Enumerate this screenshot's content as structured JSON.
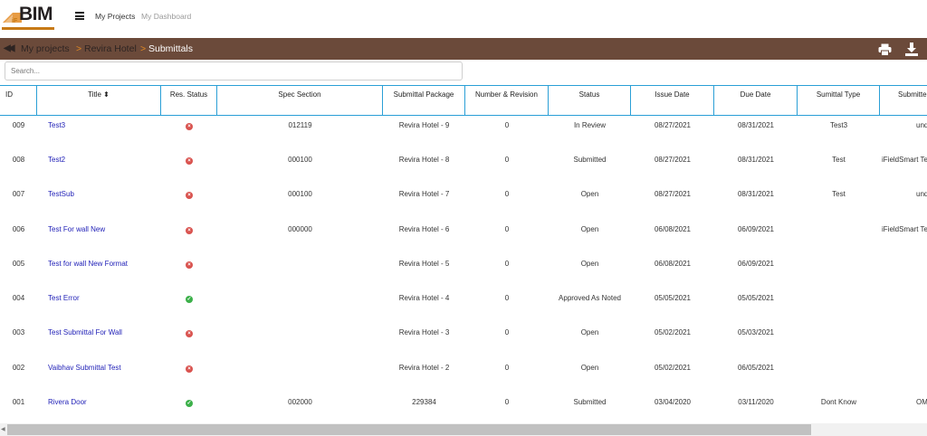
{
  "header": {
    "logo_text": "BIM",
    "logo_small": "iF",
    "nav": [
      "My Projects",
      "My Dashboard"
    ]
  },
  "breadcrumb": {
    "items": [
      "My projects",
      "Revira Hotel",
      "Submittals"
    ],
    "separator": ">"
  },
  "search": {
    "placeholder": "Search..."
  },
  "table": {
    "columns": [
      "ID",
      "Title ⬍",
      "Res. Status",
      "Spec Section",
      "Submittal Package",
      "Number & Revision",
      "Status",
      "Issue Date",
      "Due Date",
      "Sumittal Type",
      "Submitte"
    ],
    "rows": [
      {
        "id": "009",
        "title": "Test3",
        "res_status": "rejected",
        "spec": "012119",
        "package": "Revira Hotel - 9",
        "number": "0",
        "status": "In Review",
        "issue": "08/27/2021",
        "due": "08/31/2021",
        "type": "Test3",
        "submitter": "undefir"
      },
      {
        "id": "008",
        "title": "Test2",
        "res_status": "rejected",
        "spec": "000100",
        "package": "Revira Hotel - 8",
        "number": "0",
        "status": "Submitted",
        "issue": "08/27/2021",
        "due": "08/31/2021",
        "type": "Test",
        "submitter": "iFieldSmart Te"
      },
      {
        "id": "007",
        "title": "TestSub",
        "res_status": "rejected",
        "spec": "000100",
        "package": "Revira Hotel - 7",
        "number": "0",
        "status": "Open",
        "issue": "08/27/2021",
        "due": "08/31/2021",
        "type": "Test",
        "submitter": "undefir"
      },
      {
        "id": "006",
        "title": "Test For wall New",
        "res_status": "rejected",
        "spec": "000000",
        "package": "Revira Hotel - 6",
        "number": "0",
        "status": "Open",
        "issue": "06/08/2021",
        "due": "06/09/2021",
        "type": "",
        "submitter": "iFieldSmart Te"
      },
      {
        "id": "005",
        "title": "Test for wall New Format",
        "res_status": "rejected",
        "spec": "",
        "package": "Revira Hotel - 5",
        "number": "0",
        "status": "Open",
        "issue": "06/08/2021",
        "due": "06/09/2021",
        "type": "",
        "submitter": ""
      },
      {
        "id": "004",
        "title": "Test Error",
        "res_status": "approved",
        "spec": "",
        "package": "Revira Hotel - 4",
        "number": "0",
        "status": "Approved As Noted",
        "issue": "05/05/2021",
        "due": "05/05/2021",
        "type": "",
        "submitter": ""
      },
      {
        "id": "003",
        "title": "Test Submittal For Wall",
        "res_status": "rejected",
        "spec": "",
        "package": "Revira Hotel - 3",
        "number": "0",
        "status": "Open",
        "issue": "05/02/2021",
        "due": "05/03/2021",
        "type": "",
        "submitter": ""
      },
      {
        "id": "002",
        "title": "Vaibhav Submittal Test",
        "res_status": "rejected",
        "spec": "",
        "package": "Revira Hotel - 2",
        "number": "0",
        "status": "Open",
        "issue": "05/02/2021",
        "due": "06/05/2021",
        "type": "",
        "submitter": ""
      },
      {
        "id": "001",
        "title": "Rivera Door",
        "res_status": "approved",
        "spec": "002000",
        "package": "229384",
        "number": "0",
        "status": "Submitted",
        "issue": "03/04/2020",
        "due": "03/11/2020",
        "type": "Dont Know",
        "submitter": "OM"
      }
    ]
  },
  "icons": {
    "rejected": "x-circle-icon",
    "approved": "check-circle-icon",
    "print": "print-icon",
    "download": "download-icon",
    "menu": "hamburger-menu-icon",
    "back": "double-chevron-left-icon"
  },
  "colors": {
    "breadcrumb_bg": "#6b4a3a",
    "accent_orange": "#e38a22",
    "header_border": "#2a9fd6",
    "link": "#2323b8",
    "rejected": "#d9534f",
    "approved": "#3cb04a"
  }
}
